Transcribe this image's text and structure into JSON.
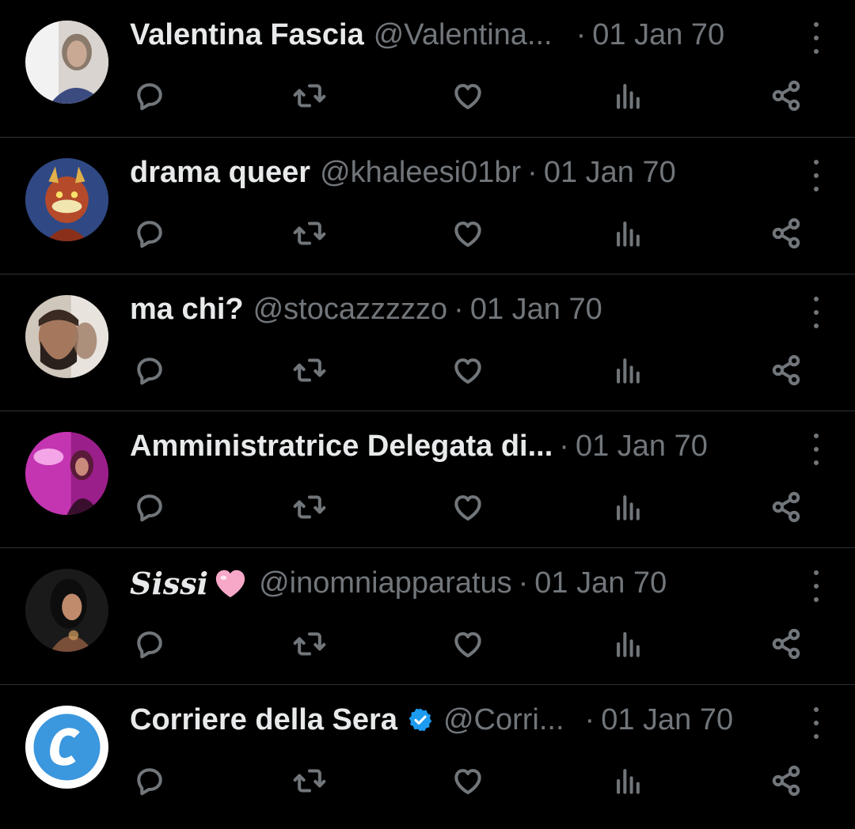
{
  "colors": {
    "background": "#000000",
    "text_primary": "#e7e9ea",
    "text_secondary": "#71767b",
    "divider": "#2f3336",
    "verified": "#1d9bf0"
  },
  "icons": {
    "reply": "reply-icon",
    "retweet": "retweet-icon",
    "like": "heart-icon",
    "views": "views-icon",
    "share": "share-icon",
    "more": "more-icon"
  },
  "tweets": [
    {
      "name": "Valentina Fascia",
      "handle": "@Valentina...",
      "separator": "·",
      "date": "01 Jan 70"
    },
    {
      "name": "drama queer",
      "handle": "@khaleesi01br",
      "separator": "·",
      "date": "01 Jan 70"
    },
    {
      "name": "ma chi?",
      "handle": "@stocazzzzzo",
      "separator": "·",
      "date": "01 Jan 70"
    },
    {
      "name": "Amministratrice Delegata di...",
      "handle": "",
      "separator": "·",
      "date": "01 Jan 70"
    },
    {
      "name": "Sissi",
      "handle": "@inomniapparatus",
      "separator": "·",
      "date": "01 Jan 70"
    },
    {
      "name": "Corriere della Sera",
      "handle": "@Corri...",
      "separator": "·",
      "date": "01 Jan 70",
      "verified": true
    }
  ]
}
